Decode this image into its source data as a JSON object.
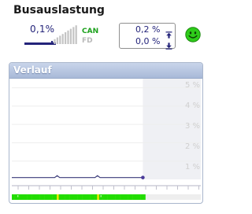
{
  "title": "Busauslastung",
  "bus_load": {
    "value": "0,1%",
    "level_fraction": 0.1
  },
  "bus_types": {
    "can": "CAN",
    "fd": "FD",
    "active": "CAN"
  },
  "peak": {
    "max": "0,2 %",
    "min": "0,0 %",
    "max_icon": "arrow-up-to-line-icon",
    "min_icon": "arrow-down-to-line-icon"
  },
  "status": {
    "icon": "smiley-happy-icon",
    "color": "#2ecc1a"
  },
  "history": {
    "title": "Verlauf",
    "tick_labels": [
      "5 %",
      "4 %",
      "3 %",
      "2 %",
      "1 %"
    ],
    "colors": {
      "line": "#3a3a7a",
      "ok": "#22dd00",
      "warn": "#f2e600"
    }
  },
  "chart_data": {
    "type": "line",
    "title": "Verlauf",
    "ylim": [
      0,
      5.5
    ],
    "ylabel": "",
    "series": [
      {
        "values": [
          0.1,
          0.1,
          0.1,
          0.1,
          0.1,
          0.1,
          0.1,
          0.1,
          0.1,
          0.1,
          0.1,
          0.1,
          0.1,
          0.1,
          0.1,
          0.1,
          0.1,
          0.1,
          0.2,
          0.1,
          0.1,
          0.1,
          0.1,
          0.1,
          0.1,
          0.1,
          0.1,
          0.1,
          0.1,
          0.1,
          0.1,
          0.1,
          0.1,
          0.1,
          0.2,
          0.1,
          0.1,
          0.1,
          0.1,
          0.1,
          0.1,
          0.1,
          0.1,
          0.1,
          0.1,
          0.1,
          0.1,
          0.1,
          0.1,
          0.1,
          0.1,
          0.1,
          0.1
        ]
      }
    ],
    "status_strip": [
      "ok",
      "ok",
      "ok",
      "ok",
      "ok",
      "ok",
      "ok",
      "ok",
      "ok",
      "ok",
      "ok",
      "ok",
      "ok",
      "ok",
      "ok",
      "ok",
      "ok",
      "ok",
      "ok",
      "ok",
      "ok",
      "ok",
      "ok",
      "ok",
      "ok",
      "ok",
      "ok",
      "ok",
      "ok",
      "ok",
      "ok",
      "ok",
      "ok",
      "ok",
      "ok",
      "ok",
      "ok",
      "ok",
      "ok",
      "ok",
      "ok",
      "ok",
      "ok",
      "ok",
      "ok",
      "ok",
      "ok",
      "ok",
      "ok",
      "ok",
      "ok",
      "ok",
      "ok"
    ],
    "grid": true
  }
}
